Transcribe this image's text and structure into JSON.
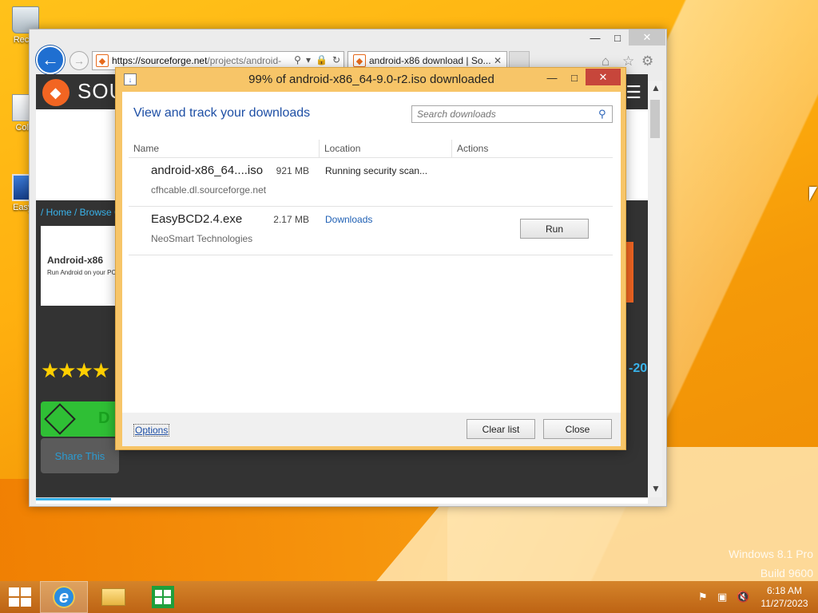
{
  "desktop": {
    "icons": [
      {
        "label": "Recyc",
        "icon": "recycle-bin-icon"
      },
      {
        "label": "Colla",
        "icon": "document-icon"
      },
      {
        "label": "EasyB",
        "icon": "computer-shortcut-icon"
      }
    ],
    "watermark_line1": "Windows 8.1 Pro",
    "watermark_line2": "Build 9600"
  },
  "browser": {
    "address_host": "https://sourceforge.net",
    "address_path": "/projects/android-",
    "tab_title": "android-x86 download | So...",
    "close_symbol": "✕",
    "page": {
      "site_name": "SOU",
      "breadcrumb": "/ Home / Browse C",
      "project_name": "Android-x86",
      "project_tagline": "Run Android on your PC",
      "stars": "★★★★",
      "year_fragment": "-20",
      "download_fragment": "D",
      "share_label": "Share This"
    }
  },
  "download_dialog": {
    "title": "99% of android-x86_64-9.0-r2.iso downloaded",
    "heading": "View and track your downloads",
    "search_placeholder": "Search downloads",
    "columns": {
      "name": "Name",
      "location": "Location",
      "actions": "Actions"
    },
    "items": [
      {
        "name": "android-x86_64....iso",
        "size": "921 MB",
        "source": "cfhcable.dl.sourceforge.net",
        "location": "Running security scan..."
      },
      {
        "name": "EasyBCD2.4.exe",
        "size": "2.17 MB",
        "source": "NeoSmart Technologies",
        "location": "Downloads",
        "action": "Run"
      }
    ],
    "options_label": "Options",
    "clear_list_label": "Clear list",
    "close_label": "Close"
  },
  "taskbar": {
    "clock_time": "6:18 AM",
    "clock_date": "11/27/2023"
  },
  "colors": {
    "accent_blue": "#1e4fa5",
    "dialog_frame": "#f7c568",
    "close_red": "#c7463b",
    "sourceforge_orange": "#f26522"
  }
}
